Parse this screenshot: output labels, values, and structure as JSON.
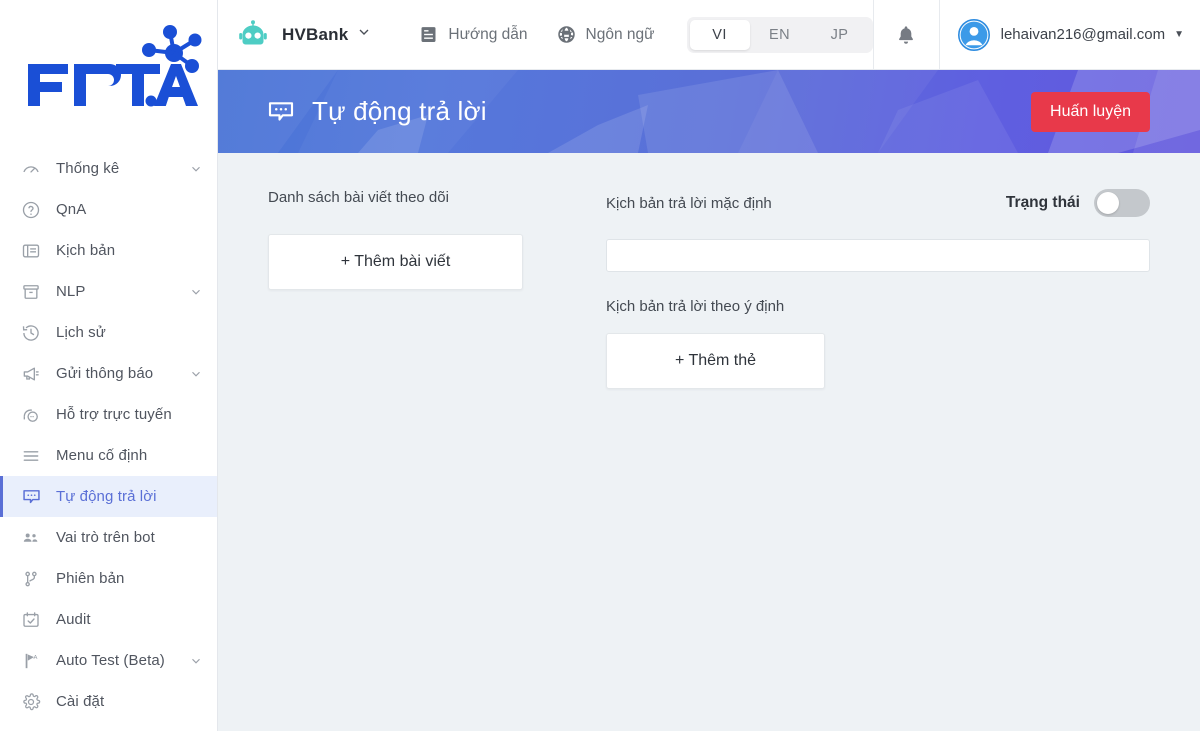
{
  "brand": {
    "logo_text": "FPT.AI"
  },
  "topbar": {
    "bot_icon": "robot-icon",
    "bot_name": "HVBank",
    "links": [
      {
        "icon": "guide-document-icon",
        "label": "Hướng dẫn"
      },
      {
        "icon": "globe-icon",
        "label": "Ngôn ngữ"
      }
    ],
    "languages": [
      {
        "code": "VI",
        "active": true
      },
      {
        "code": "EN",
        "active": false
      },
      {
        "code": "JP",
        "active": false
      }
    ],
    "notification_icon": "bell-icon",
    "user": {
      "avatar": "user-avatar-icon",
      "email": "lehaivan216@gmail.com",
      "caret": "chevron-down-icon"
    }
  },
  "sidebar": {
    "items": [
      {
        "icon": "dashboard-gauge-icon",
        "label": "Thống kê",
        "expandable": true,
        "active": false
      },
      {
        "icon": "question-circle-icon",
        "label": "QnA",
        "expandable": false,
        "active": false
      },
      {
        "icon": "script-card-icon",
        "label": "Kịch bản",
        "expandable": false,
        "active": false
      },
      {
        "icon": "archive-box-icon",
        "label": "NLP",
        "expandable": true,
        "active": false
      },
      {
        "icon": "history-clock-icon",
        "label": "Lịch sử",
        "expandable": false,
        "active": false
      },
      {
        "icon": "megaphone-icon",
        "label": "Gửi thông báo",
        "expandable": true,
        "active": false
      },
      {
        "icon": "live-chat-support-icon",
        "label": "Hỗ trợ trực tuyến",
        "expandable": false,
        "active": false
      },
      {
        "icon": "hamburger-menu-icon",
        "label": "Menu cố định",
        "expandable": false,
        "active": false
      },
      {
        "icon": "chat-bubble-icon",
        "label": "Tự động trả lời",
        "expandable": false,
        "active": true
      },
      {
        "icon": "people-group-icon",
        "label": "Vai trò trên bot",
        "expandable": false,
        "active": false
      },
      {
        "icon": "branch-icon",
        "label": "Phiên bản",
        "expandable": false,
        "active": false
      },
      {
        "icon": "calendar-check-icon",
        "label": "Audit",
        "expandable": false,
        "active": false
      },
      {
        "icon": "flag-beta-icon",
        "label": "Auto Test (Beta)",
        "expandable": true,
        "active": false
      },
      {
        "icon": "gear-icon",
        "label": "Cài đặt",
        "expandable": false,
        "active": false
      }
    ]
  },
  "banner": {
    "icon": "chat-bubble-icon",
    "title": "Tự động trả lời",
    "train_button": "Huấn luyện"
  },
  "main": {
    "articles": {
      "label": "Danh sách bài viết theo dõi",
      "add_button": "+ Thêm bài viết"
    },
    "default_reply": {
      "label": "Kịch bản trả lời mặc định",
      "status_label": "Trạng thái",
      "status_on": false,
      "input_value": "",
      "input_placeholder": ""
    },
    "intent_reply": {
      "label": "Kịch bản trả lời theo ý định",
      "add_button": "+ Thêm thẻ"
    }
  },
  "colors": {
    "accent_blue": "#5a6fd6",
    "banner_start": "#4a74d6",
    "banner_end": "#6157dd",
    "train_red": "#e8394a",
    "bot_teal": "#4ecdc4",
    "content_bg": "#eef2f5",
    "logo_blue": "#1a4fd6"
  }
}
